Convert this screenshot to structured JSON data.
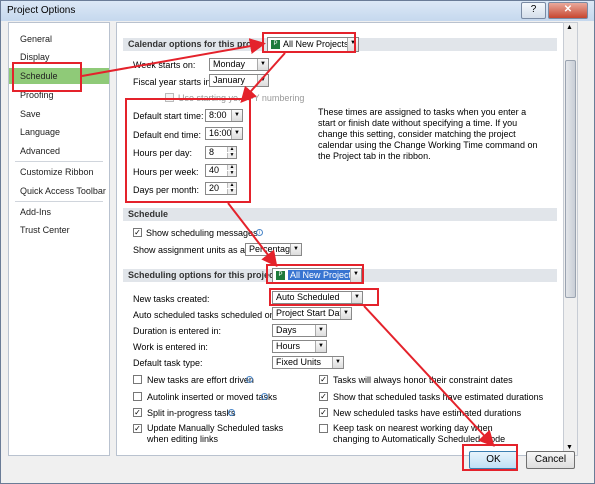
{
  "window": {
    "title": "Project Options",
    "help": "?",
    "close": "✕"
  },
  "nav": {
    "items": [
      {
        "label": "General"
      },
      {
        "label": "Display"
      },
      {
        "label": "Schedule"
      },
      {
        "label": "Proofing"
      },
      {
        "label": "Save"
      },
      {
        "label": "Language"
      },
      {
        "label": "Advanced"
      },
      {
        "label": "Customize Ribbon"
      },
      {
        "label": "Quick Access Toolbar"
      },
      {
        "label": "Add-Ins"
      },
      {
        "label": "Trust Center"
      }
    ]
  },
  "calendar": {
    "heading": "Calendar options for this proje",
    "project_select": "All New Projects",
    "week_starts_label": "Week starts on:",
    "week_starts_value": "Monday",
    "fiscal_label": "Fiscal year starts in:",
    "fiscal_value": "January",
    "fy_numbering": "Use starting ye... FY numbering",
    "start_time_label": "Default start time:",
    "start_time_value": "8:00",
    "end_time_label": "Default end time:",
    "end_time_value": "16:00",
    "hours_day_label": "Hours per day:",
    "hours_day_value": "8",
    "hours_week_label": "Hours per week:",
    "hours_week_value": "40",
    "days_month_label": "Days per month:",
    "days_month_value": "20",
    "note": "These times are assigned to tasks when you enter a start or finish date without specifying a time. If you change this setting, consider matching the project calendar using the Change Working Time command on the Project tab in the ribbon."
  },
  "schedule": {
    "heading": "Schedule",
    "show_messages": "Show scheduling messages",
    "units_label": "Show assignment units as a:",
    "units_value": "Percentage"
  },
  "scheduling": {
    "heading": "Scheduling options for this project:",
    "project_select": "All New Projects",
    "new_tasks_label": "New tasks created:",
    "new_tasks_value": "Auto Scheduled",
    "auto_sched_label": "Auto scheduled tasks scheduled on:",
    "auto_sched_value": "Project Start Date",
    "duration_label": "Duration is entered in:",
    "duration_value": "Days",
    "work_label": "Work is entered in:",
    "work_value": "Hours",
    "task_type_label": "Default task type:",
    "task_type_value": "Fixed Units",
    "checks_left": [
      {
        "label": "New tasks are effort driven",
        "checked": false
      },
      {
        "label": "Autolink inserted or moved tasks",
        "checked": false
      },
      {
        "label": "Split in-progress tasks",
        "checked": true
      },
      {
        "label": "Update Manually Scheduled tasks when editing links",
        "checked": true
      }
    ],
    "checks_right": [
      {
        "label": "Tasks will always honor their constraint dates",
        "checked": true
      },
      {
        "label": "Show that scheduled tasks have estimated durations",
        "checked": true
      },
      {
        "label": "New scheduled tasks have estimated durations",
        "checked": true
      },
      {
        "label": "Keep task on nearest working day when changing to Automatically Scheduled mode",
        "checked": false
      }
    ]
  },
  "buttons": {
    "ok": "OK",
    "cancel": "Cancel"
  },
  "colors": {
    "selected_nav": "#8fca78",
    "annotation": "#e4222b"
  }
}
